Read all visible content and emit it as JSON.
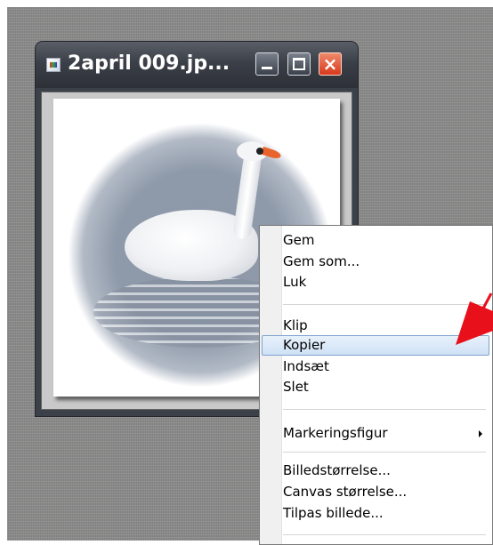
{
  "window": {
    "title": "2april 009.jp...",
    "buttons": {
      "minimize": "minimize",
      "maximize": "maximize",
      "close": "×"
    }
  },
  "image": {
    "description_icon": "image-file-icon"
  },
  "context_menu": {
    "items": [
      {
        "label": "Gem"
      },
      {
        "label": "Gem som..."
      },
      {
        "label": "Luk"
      },
      {
        "label": "Klip"
      },
      {
        "label": "Kopier"
      },
      {
        "label": "Indsæt"
      },
      {
        "label": "Slet"
      },
      {
        "label": "Markeringsfigur"
      },
      {
        "label": "Billedstørrelse..."
      },
      {
        "label": "Canvas størrelse..."
      },
      {
        "label": "Tilpas billede..."
      }
    ],
    "highlighted_index": 4
  },
  "colors": {
    "annotation_arrow": "#e8101a",
    "highlight": "#cfe1f6",
    "close_button": "#d7391b"
  }
}
